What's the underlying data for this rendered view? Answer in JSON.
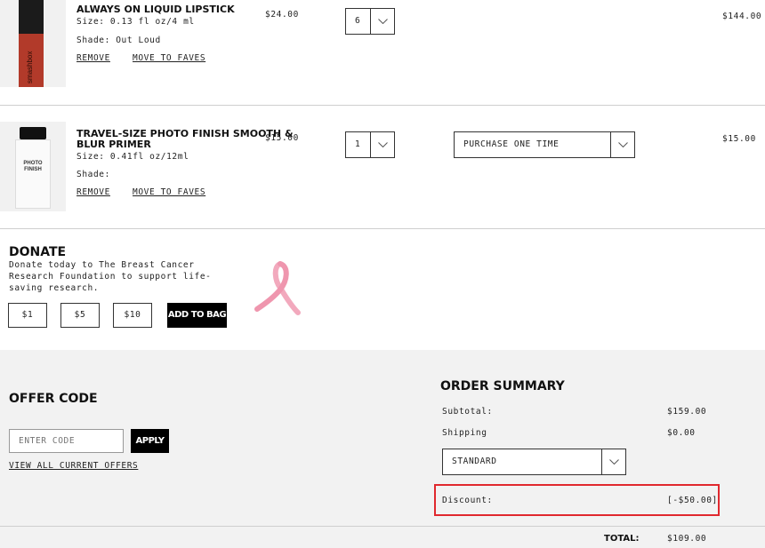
{
  "cart": {
    "items": [
      {
        "name": "ALWAYS ON LIQUID LIPSTICK",
        "size": "Size: 0.13 fl oz/4 ml",
        "shade": "Shade: Out Loud",
        "price": "$24.00",
        "qty": "6",
        "line_total": "$144.00",
        "remove": "REMOVE",
        "move": "MOVE TO FAVES",
        "image_color": "#b23a2a"
      },
      {
        "name_line1": "TRAVEL-SIZE PHOTO FINISH SMOOTH &",
        "name_line2": "BLUR PRIMER",
        "size": "Size: 0.41fl oz/12ml",
        "shade": "Shade:",
        "price": "$15.00",
        "qty": "1",
        "purchase_option": "PURCHASE ONE TIME",
        "line_total": "$15.00",
        "remove": "REMOVE",
        "move": "MOVE TO FAVES",
        "tube_text": "PHOTO FINISH"
      }
    ]
  },
  "donate": {
    "title": "DONATE",
    "desc_line1": "Donate today to The Breast Cancer",
    "desc_line2": "Research Foundation to support life-",
    "desc_line3": "saving research.",
    "amounts": [
      "$1",
      "$5",
      "$10"
    ],
    "add_button": "ADD TO BAG",
    "ribbon_color": "#f2a9bd"
  },
  "offer": {
    "title": "OFFER CODE",
    "placeholder": "ENTER CODE",
    "apply": "APPLY",
    "view_all": "VIEW ALL CURRENT OFFERS"
  },
  "summary": {
    "title": "ORDER SUMMARY",
    "subtotal_label": "Subtotal:",
    "subtotal": "$159.00",
    "shipping_label": "Shipping",
    "shipping": "$0.00",
    "shipping_method": "STANDARD",
    "discount_label": "Discount:",
    "discount": "[-$50.00]",
    "total_label": "TOTAL:",
    "total": "$109.00",
    "highlight_color": "#e0282e"
  }
}
